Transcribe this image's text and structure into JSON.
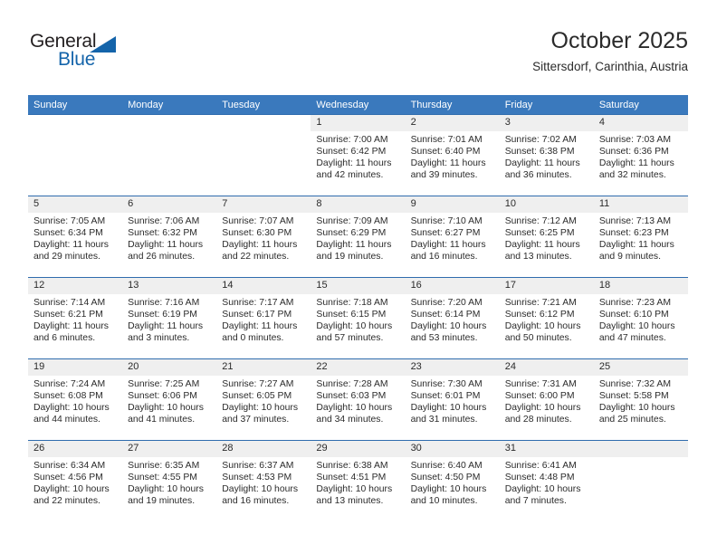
{
  "brand": {
    "name_top": "General",
    "name_bottom": "Blue",
    "accent_color": "#1464aa"
  },
  "header": {
    "title": "October 2025",
    "subtitle": "Sittersdorf, Carinthia, Austria"
  },
  "theme": {
    "header_bar_color": "#3a79bd",
    "row_rule_color": "#2f6cae",
    "daynum_band_color": "#efefef",
    "text_color": "#2b2b2b"
  },
  "weekday_headers": [
    "Sunday",
    "Monday",
    "Tuesday",
    "Wednesday",
    "Thursday",
    "Friday",
    "Saturday"
  ],
  "labels": {
    "sunrise_prefix": "Sunrise:",
    "sunset_prefix": "Sunset:",
    "daylight_prefix": "Daylight:"
  },
  "weeks": [
    [
      {
        "blank": true
      },
      {
        "blank": true
      },
      {
        "blank": true
      },
      {
        "day": "1",
        "sunrise": "Sunrise: 7:00 AM",
        "sunset": "Sunset: 6:42 PM",
        "daylight_1": "Daylight: 11 hours",
        "daylight_2": "and 42 minutes."
      },
      {
        "day": "2",
        "sunrise": "Sunrise: 7:01 AM",
        "sunset": "Sunset: 6:40 PM",
        "daylight_1": "Daylight: 11 hours",
        "daylight_2": "and 39 minutes."
      },
      {
        "day": "3",
        "sunrise": "Sunrise: 7:02 AM",
        "sunset": "Sunset: 6:38 PM",
        "daylight_1": "Daylight: 11 hours",
        "daylight_2": "and 36 minutes."
      },
      {
        "day": "4",
        "sunrise": "Sunrise: 7:03 AM",
        "sunset": "Sunset: 6:36 PM",
        "daylight_1": "Daylight: 11 hours",
        "daylight_2": "and 32 minutes."
      }
    ],
    [
      {
        "day": "5",
        "sunrise": "Sunrise: 7:05 AM",
        "sunset": "Sunset: 6:34 PM",
        "daylight_1": "Daylight: 11 hours",
        "daylight_2": "and 29 minutes."
      },
      {
        "day": "6",
        "sunrise": "Sunrise: 7:06 AM",
        "sunset": "Sunset: 6:32 PM",
        "daylight_1": "Daylight: 11 hours",
        "daylight_2": "and 26 minutes."
      },
      {
        "day": "7",
        "sunrise": "Sunrise: 7:07 AM",
        "sunset": "Sunset: 6:30 PM",
        "daylight_1": "Daylight: 11 hours",
        "daylight_2": "and 22 minutes."
      },
      {
        "day": "8",
        "sunrise": "Sunrise: 7:09 AM",
        "sunset": "Sunset: 6:29 PM",
        "daylight_1": "Daylight: 11 hours",
        "daylight_2": "and 19 minutes."
      },
      {
        "day": "9",
        "sunrise": "Sunrise: 7:10 AM",
        "sunset": "Sunset: 6:27 PM",
        "daylight_1": "Daylight: 11 hours",
        "daylight_2": "and 16 minutes."
      },
      {
        "day": "10",
        "sunrise": "Sunrise: 7:12 AM",
        "sunset": "Sunset: 6:25 PM",
        "daylight_1": "Daylight: 11 hours",
        "daylight_2": "and 13 minutes."
      },
      {
        "day": "11",
        "sunrise": "Sunrise: 7:13 AM",
        "sunset": "Sunset: 6:23 PM",
        "daylight_1": "Daylight: 11 hours",
        "daylight_2": "and 9 minutes."
      }
    ],
    [
      {
        "day": "12",
        "sunrise": "Sunrise: 7:14 AM",
        "sunset": "Sunset: 6:21 PM",
        "daylight_1": "Daylight: 11 hours",
        "daylight_2": "and 6 minutes."
      },
      {
        "day": "13",
        "sunrise": "Sunrise: 7:16 AM",
        "sunset": "Sunset: 6:19 PM",
        "daylight_1": "Daylight: 11 hours",
        "daylight_2": "and 3 minutes."
      },
      {
        "day": "14",
        "sunrise": "Sunrise: 7:17 AM",
        "sunset": "Sunset: 6:17 PM",
        "daylight_1": "Daylight: 11 hours",
        "daylight_2": "and 0 minutes."
      },
      {
        "day": "15",
        "sunrise": "Sunrise: 7:18 AM",
        "sunset": "Sunset: 6:15 PM",
        "daylight_1": "Daylight: 10 hours",
        "daylight_2": "and 57 minutes."
      },
      {
        "day": "16",
        "sunrise": "Sunrise: 7:20 AM",
        "sunset": "Sunset: 6:14 PM",
        "daylight_1": "Daylight: 10 hours",
        "daylight_2": "and 53 minutes."
      },
      {
        "day": "17",
        "sunrise": "Sunrise: 7:21 AM",
        "sunset": "Sunset: 6:12 PM",
        "daylight_1": "Daylight: 10 hours",
        "daylight_2": "and 50 minutes."
      },
      {
        "day": "18",
        "sunrise": "Sunrise: 7:23 AM",
        "sunset": "Sunset: 6:10 PM",
        "daylight_1": "Daylight: 10 hours",
        "daylight_2": "and 47 minutes."
      }
    ],
    [
      {
        "day": "19",
        "sunrise": "Sunrise: 7:24 AM",
        "sunset": "Sunset: 6:08 PM",
        "daylight_1": "Daylight: 10 hours",
        "daylight_2": "and 44 minutes."
      },
      {
        "day": "20",
        "sunrise": "Sunrise: 7:25 AM",
        "sunset": "Sunset: 6:06 PM",
        "daylight_1": "Daylight: 10 hours",
        "daylight_2": "and 41 minutes."
      },
      {
        "day": "21",
        "sunrise": "Sunrise: 7:27 AM",
        "sunset": "Sunset: 6:05 PM",
        "daylight_1": "Daylight: 10 hours",
        "daylight_2": "and 37 minutes."
      },
      {
        "day": "22",
        "sunrise": "Sunrise: 7:28 AM",
        "sunset": "Sunset: 6:03 PM",
        "daylight_1": "Daylight: 10 hours",
        "daylight_2": "and 34 minutes."
      },
      {
        "day": "23",
        "sunrise": "Sunrise: 7:30 AM",
        "sunset": "Sunset: 6:01 PM",
        "daylight_1": "Daylight: 10 hours",
        "daylight_2": "and 31 minutes."
      },
      {
        "day": "24",
        "sunrise": "Sunrise: 7:31 AM",
        "sunset": "Sunset: 6:00 PM",
        "daylight_1": "Daylight: 10 hours",
        "daylight_2": "and 28 minutes."
      },
      {
        "day": "25",
        "sunrise": "Sunrise: 7:32 AM",
        "sunset": "Sunset: 5:58 PM",
        "daylight_1": "Daylight: 10 hours",
        "daylight_2": "and 25 minutes."
      }
    ],
    [
      {
        "day": "26",
        "sunrise": "Sunrise: 6:34 AM",
        "sunset": "Sunset: 4:56 PM",
        "daylight_1": "Daylight: 10 hours",
        "daylight_2": "and 22 minutes."
      },
      {
        "day": "27",
        "sunrise": "Sunrise: 6:35 AM",
        "sunset": "Sunset: 4:55 PM",
        "daylight_1": "Daylight: 10 hours",
        "daylight_2": "and 19 minutes."
      },
      {
        "day": "28",
        "sunrise": "Sunrise: 6:37 AM",
        "sunset": "Sunset: 4:53 PM",
        "daylight_1": "Daylight: 10 hours",
        "daylight_2": "and 16 minutes."
      },
      {
        "day": "29",
        "sunrise": "Sunrise: 6:38 AM",
        "sunset": "Sunset: 4:51 PM",
        "daylight_1": "Daylight: 10 hours",
        "daylight_2": "and 13 minutes."
      },
      {
        "day": "30",
        "sunrise": "Sunrise: 6:40 AM",
        "sunset": "Sunset: 4:50 PM",
        "daylight_1": "Daylight: 10 hours",
        "daylight_2": "and 10 minutes."
      },
      {
        "day": "31",
        "sunrise": "Sunrise: 6:41 AM",
        "sunset": "Sunset: 4:48 PM",
        "daylight_1": "Daylight: 10 hours",
        "daylight_2": "and 7 minutes."
      },
      {
        "empty": true
      }
    ]
  ]
}
